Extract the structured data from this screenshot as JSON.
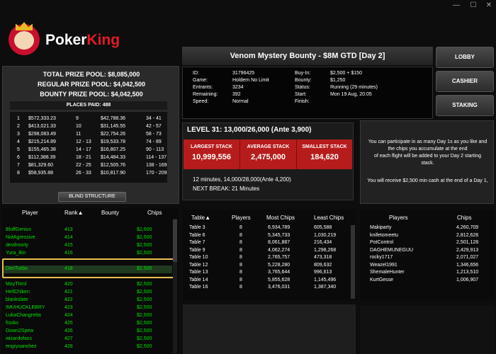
{
  "window": {
    "minimize": "—",
    "maximize": "☐",
    "close": "✕"
  },
  "brand": {
    "name_a": "Poker",
    "name_b": "King"
  },
  "buttons": {
    "lobby": "LOBBY",
    "cashier": "CASHIER",
    "staking": "STAKING"
  },
  "tournament": {
    "title": "Venom Mystery Bounty - $8M GTD [Day 2]",
    "info_left": [
      {
        "k": "ID:",
        "v": "31796425"
      },
      {
        "k": "Game:",
        "v": "Holdem No Limit"
      },
      {
        "k": "Entrants:",
        "v": "3234"
      },
      {
        "k": "Remaining:",
        "v": "392"
      },
      {
        "k": "Speed:",
        "v": "Normal"
      }
    ],
    "info_right": [
      {
        "k": "Buy-In:",
        "v": "$2,500 + $150"
      },
      {
        "k": "Bounty:",
        "v": "$1,250"
      },
      {
        "k": "Status:",
        "v": "Running (29 minutes)"
      },
      {
        "k": "Start:",
        "v": "Mon 19 Aug, 20:05"
      },
      {
        "k": "Finish:",
        "v": ""
      }
    ]
  },
  "prize": {
    "total": "TOTAL PRIZE POOL: $8,085,000",
    "regular": "REGULAR PRIZE POOL: $4,042,500",
    "bounty": "BOUNTY PRIZE POOL: $4,042,500",
    "places_paid": "PLACES PAID: 488",
    "places": [
      [
        "1",
        "$572,333.23",
        "9",
        "$42,788.36",
        "34 - 41"
      ],
      [
        "2",
        "$413,021.33",
        "10",
        "$31,145.55",
        "42 - 57"
      ],
      [
        "3",
        "$298,083.49",
        "11",
        "$22,754.26",
        "58 - 73"
      ],
      [
        "4",
        "$215,214.89",
        "12 - 13",
        "$19,533.78",
        "74 - 89"
      ],
      [
        "5",
        "$155,465.38",
        "14 - 17",
        "$16,807.25",
        "90 - 113"
      ],
      [
        "6",
        "$112,388.39",
        "18 - 21",
        "$14,484.33",
        "114 - 137"
      ],
      [
        "7",
        "$81,329.60",
        "22 - 25",
        "$12,505.76",
        "138 - 169"
      ],
      [
        "8",
        "$58,935.88",
        "26 - 33",
        "$10,817.90",
        "170 - 209"
      ]
    ],
    "blind_structure": "BLIND STRUCTURE"
  },
  "level": {
    "title": "LEVEL 31: 13,000/26,000 (Ante 3,900)",
    "largest_label": "LARGEST STACK",
    "largest_value": "10,999,556",
    "average_label": "AVERAGE STACK",
    "average_value": "2,475,000",
    "smallest_label": "SMALLEST STACK",
    "smallest_value": "184,620",
    "next_level": "12 minutes, 14,000/28,000(Ante 4,200)",
    "next_break": "NEXT BREAK: 21 Minutes"
  },
  "message": {
    "line1": "You can participate in as many Day 1s as you like and",
    "line2": "the chips you accumulate at the end",
    "line3": "of each flight will be added to your Day 2 starting",
    "line4": "stack.",
    "line5": "You will receive $2,500 min cash at the end of a Day 1,"
  },
  "players": {
    "headers": {
      "player": "Player",
      "rank": "Rank▲",
      "bounty": "Bounty",
      "chips": "Chips"
    },
    "rows": [
      {
        "name": "BluffGenius",
        "rank": "413",
        "bounty": "",
        "chips": "$2,500"
      },
      {
        "name": "NotAgressive",
        "rank": "414",
        "bounty": "",
        "chips": "$2,500"
      },
      {
        "name": "devilmorty",
        "rank": "415",
        "bounty": "",
        "chips": "$2,500"
      },
      {
        "name": "Yura_Bin",
        "rank": "416",
        "bounty": "",
        "chips": "$2,500"
      },
      {
        "name": "DenTurbo",
        "rank": "418",
        "bounty": "",
        "chips": "$2,500"
      },
      {
        "name": "MayThird",
        "rank": "420",
        "bounty": "",
        "chips": "$2,500"
      },
      {
        "name": "HellChiken",
        "rank": "421",
        "bounty": "",
        "chips": "$2,500"
      },
      {
        "name": "blankslate",
        "rank": "422",
        "bounty": "",
        "chips": "$2,500"
      },
      {
        "name": "IMUHUCKLEBRY",
        "rank": "423",
        "bounty": "",
        "chips": "$2,500"
      },
      {
        "name": "LukaChangretta",
        "rank": "424",
        "bounty": "",
        "chips": "$2,500"
      },
      {
        "name": "fissko",
        "rank": "425",
        "bounty": "",
        "chips": "$2,500"
      },
      {
        "name": "Down2Spew",
        "rank": "426",
        "bounty": "",
        "chips": "$2,500"
      },
      {
        "name": "wizardofass",
        "rank": "427",
        "bounty": "",
        "chips": "$2,500"
      },
      {
        "name": "engrysanchez",
        "rank": "428",
        "bounty": "",
        "chips": "$2,500"
      }
    ]
  },
  "tables": {
    "headers": {
      "table": "Table▲",
      "players": "Players",
      "most": "Most Chips",
      "least": "Least Chips"
    },
    "rows": [
      {
        "table": "Table 3",
        "players": "8",
        "most": "6,934,789",
        "least": "605,588"
      },
      {
        "table": "Table 6",
        "players": "8",
        "most": "5,345,733",
        "least": "1,030,219"
      },
      {
        "table": "Table 7",
        "players": "8",
        "most": "8,061,887",
        "least": "216,434"
      },
      {
        "table": "Table 9",
        "players": "8",
        "most": "4,062,274",
        "least": "1,298,268"
      },
      {
        "table": "Table 10",
        "players": "8",
        "most": "2,765,757",
        "least": "473,318"
      },
      {
        "table": "Table 12",
        "players": "8",
        "most": "5,228,280",
        "least": "809,632"
      },
      {
        "table": "Table 13",
        "players": "8",
        "most": "3,765,644",
        "least": "996,613"
      },
      {
        "table": "Table 14",
        "players": "8",
        "most": "5,855,628",
        "least": "1,145,496"
      },
      {
        "table": "Table 16",
        "players": "8",
        "most": "3,476,031",
        "least": "1,387,340"
      }
    ]
  },
  "leaders": {
    "headers": {
      "players": "Players",
      "chips": "Chips"
    },
    "rows": [
      {
        "name": "Makiparty",
        "chips": "4,260,709"
      },
      {
        "name": "knifetomeetu",
        "chips": "2,812,628"
      },
      {
        "name": "PotControl",
        "chips": "2,501,128"
      },
      {
        "name": "DAGHEMUNEGUU",
        "chips": "2,429,913"
      },
      {
        "name": "rocky1717",
        "chips": "2,071,027"
      },
      {
        "name": "Weazel1991",
        "chips": "1,346,656"
      },
      {
        "name": "ShemaleHunter",
        "chips": "1,213,510"
      },
      {
        "name": "KurtGesse",
        "chips": "1,006,907"
      }
    ]
  }
}
